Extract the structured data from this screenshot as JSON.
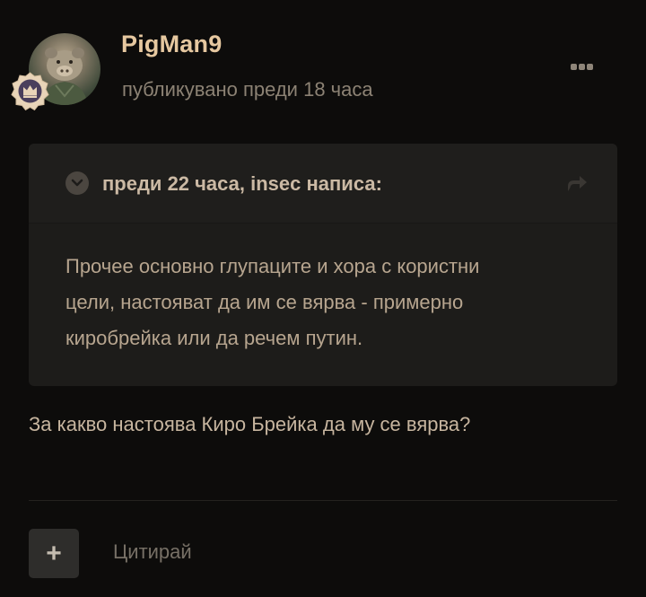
{
  "post": {
    "author": {
      "name": "PigMan9",
      "avatar_icon": "pig-avatar-image",
      "badge_icon": "crown-rank-badge-icon"
    },
    "meta": "публикувано преди 18 часа",
    "more_icon": "ellipsis-icon",
    "quote": {
      "toggle_icon": "chevron-down-icon",
      "citation": "преди 22 часа, insec написа:",
      "share_icon": "share-arrow-icon",
      "lines": [
        "Прочее основно глупаците и хора с користни",
        "цели, настояват да им се вярва - примерно",
        "киробрейка или да речем путин."
      ]
    },
    "content": "За какво настоява Киро Брейка да му се вярва?",
    "actions": {
      "add_label": "+",
      "quote_label": "Цитирай"
    },
    "colors": {
      "background": "#0d0c0b",
      "author_name": "#e6c8a0",
      "quote_background": "#1d1c1a"
    }
  }
}
